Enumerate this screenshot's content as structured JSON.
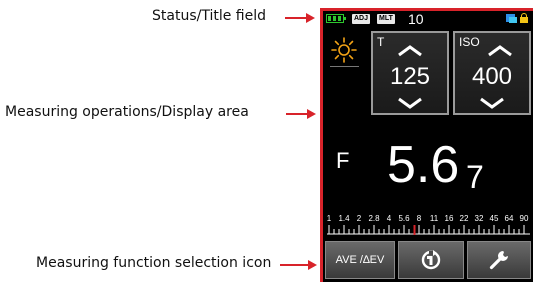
{
  "annotations": {
    "status_title": "Status/Title field",
    "measuring_display": "Measuring operations/Display area",
    "function_icon": "Measuring function selection icon"
  },
  "status_bar": {
    "adj_tag": "ADJ",
    "mlt_tag": "MLT",
    "multi_count": "10"
  },
  "shutter": {
    "label": "T",
    "value": "125"
  },
  "iso": {
    "label": "ISO",
    "value": "400"
  },
  "aperture": {
    "label": "F",
    "main": "5.6",
    "tenths": "7"
  },
  "scale": {
    "labels": [
      "1",
      "1.4",
      "2",
      "2.8",
      "4",
      "5.6",
      "8",
      "11",
      "16",
      "22",
      "32",
      "45",
      "64",
      "90"
    ],
    "marker_value": "5.6"
  },
  "function_bar": {
    "ave_button": "AVE /∆EV",
    "icons": [
      "memory-cycle-icon",
      "wrench-icon"
    ]
  },
  "colors": {
    "frame_red": "#d8232a",
    "battery_green": "#2ec82e",
    "lock_yellow": "#f2c316"
  }
}
